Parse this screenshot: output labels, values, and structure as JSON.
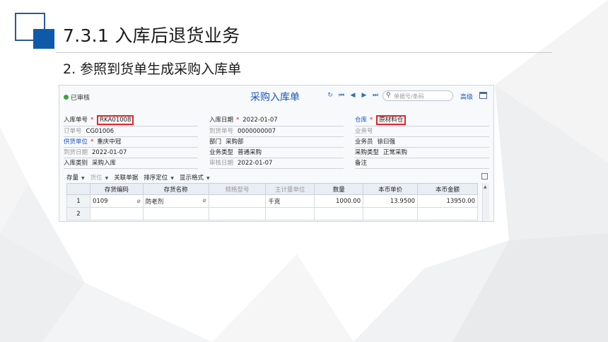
{
  "slide": {
    "title": "7.3.1  入库后退货业务",
    "subtitle": "2. 参照到货单生成采购入库单"
  },
  "app": {
    "status": "已审核",
    "doc_title": "采购入库单",
    "search_placeholder": "单据号/条码",
    "advanced_label": "高级",
    "fields": {
      "receipt_no_label": "入库单号",
      "receipt_no": "RKA01008",
      "receipt_date_label": "入库日期",
      "receipt_date": "2022-01-07",
      "warehouse_label": "仓库",
      "warehouse": "原材料仓",
      "order_no_label": "订单号",
      "order_no": "CG01006",
      "arrival_no_label": "到货单号",
      "arrival_no": "0000000007",
      "business_no_label": "业务号",
      "supplier_label": "供货单位",
      "supplier": "重庆中冠",
      "department_label": "部门",
      "department": "采购部",
      "clerk_label": "业务员",
      "clerk": "徐曰强",
      "arrival_date_label": "到货日期",
      "arrival_date": "2022-01-07",
      "business_type_label": "业务类型",
      "business_type": "普通采购",
      "purchase_type_label": "采购类型",
      "purchase_type": "正常采购",
      "receipt_category_label": "入库类别",
      "receipt_category": "采购入库",
      "audit_date_label": "审核日期",
      "audit_date": "2022-01-07",
      "remark_label": "备注"
    },
    "toolbar": {
      "stock": "存量",
      "allocate": "货位",
      "related": "关联单据",
      "sort": "排序定位",
      "display": "显示格式"
    },
    "table": {
      "headers": [
        "存货编码",
        "存货名称",
        "规格型号",
        "主计量单位",
        "数量",
        "本币单价",
        "本币金额"
      ],
      "rows": [
        {
          "no": "1",
          "code": "0109",
          "name": "防老剂",
          "spec": "",
          "unit": "千克",
          "qty": "1000.00",
          "price": "13.9500",
          "amount": "13950.00"
        },
        {
          "no": "2",
          "code": "",
          "name": "",
          "spec": "",
          "unit": "",
          "qty": "",
          "price": "",
          "amount": ""
        }
      ]
    }
  }
}
